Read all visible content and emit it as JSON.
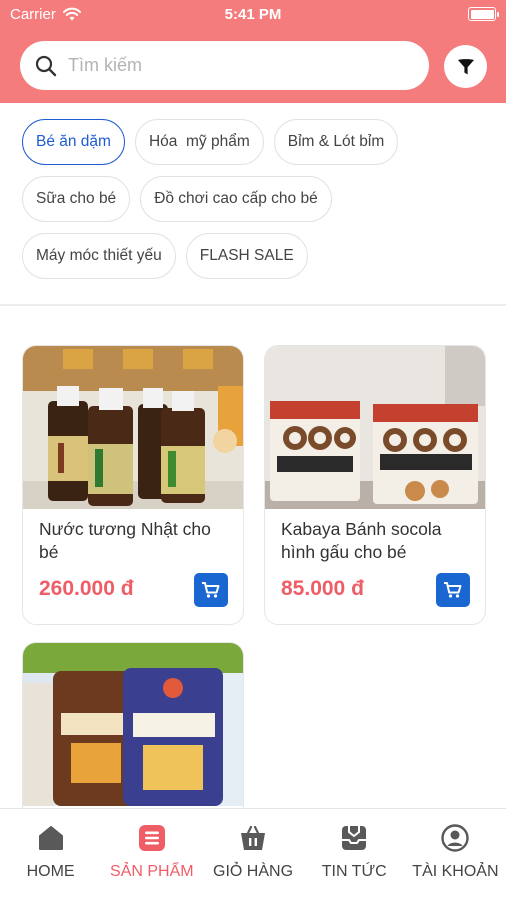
{
  "status_bar": {
    "carrier": "Carrier",
    "time": "5:41 PM"
  },
  "search": {
    "placeholder": "Tìm kiếm",
    "value": ""
  },
  "icons": {
    "search": "search-icon",
    "filter": "funnel-icon",
    "cart": "cart-icon",
    "wifi": "wifi-icon",
    "battery": "battery-icon"
  },
  "categories": {
    "selected": "Bé ăn dặm",
    "items": [
      "Bé ăn dặm",
      "Hóa  mỹ phẩm",
      "Bỉm & Lót bỉm",
      "Sữa cho bé",
      "Đồ chơi cao cấp cho bé",
      "Máy móc thiết yếu",
      "FLASH SALE"
    ]
  },
  "products": [
    {
      "name": "Nước tương Nhật cho bé",
      "price": "260.000 đ",
      "image": "soy-sauce-bottles-photo"
    },
    {
      "name": "Kabaya Bánh socola hình gấu cho bé",
      "price": "85.000 đ",
      "image": "panda-chocolate-biscuits-photo"
    },
    {
      "name": "",
      "price": "",
      "image": "cheeza-snack-bags-photo"
    }
  ],
  "tabs": [
    {
      "label": "HOME",
      "icon": "home-icon"
    },
    {
      "label": "SẢN PHẨM",
      "icon": "product-list-icon",
      "active": true
    },
    {
      "label": "GIỎ HÀNG",
      "icon": "basket-icon"
    },
    {
      "label": "TIN TỨC",
      "icon": "news-inbox-icon"
    },
    {
      "label": "TÀI KHOẢN",
      "icon": "account-icon"
    }
  ],
  "colors": {
    "header": "#f47c7c",
    "accent_blue": "#1a67d2",
    "price_red": "#ef5d67",
    "active_tab": "#ef5d67"
  }
}
